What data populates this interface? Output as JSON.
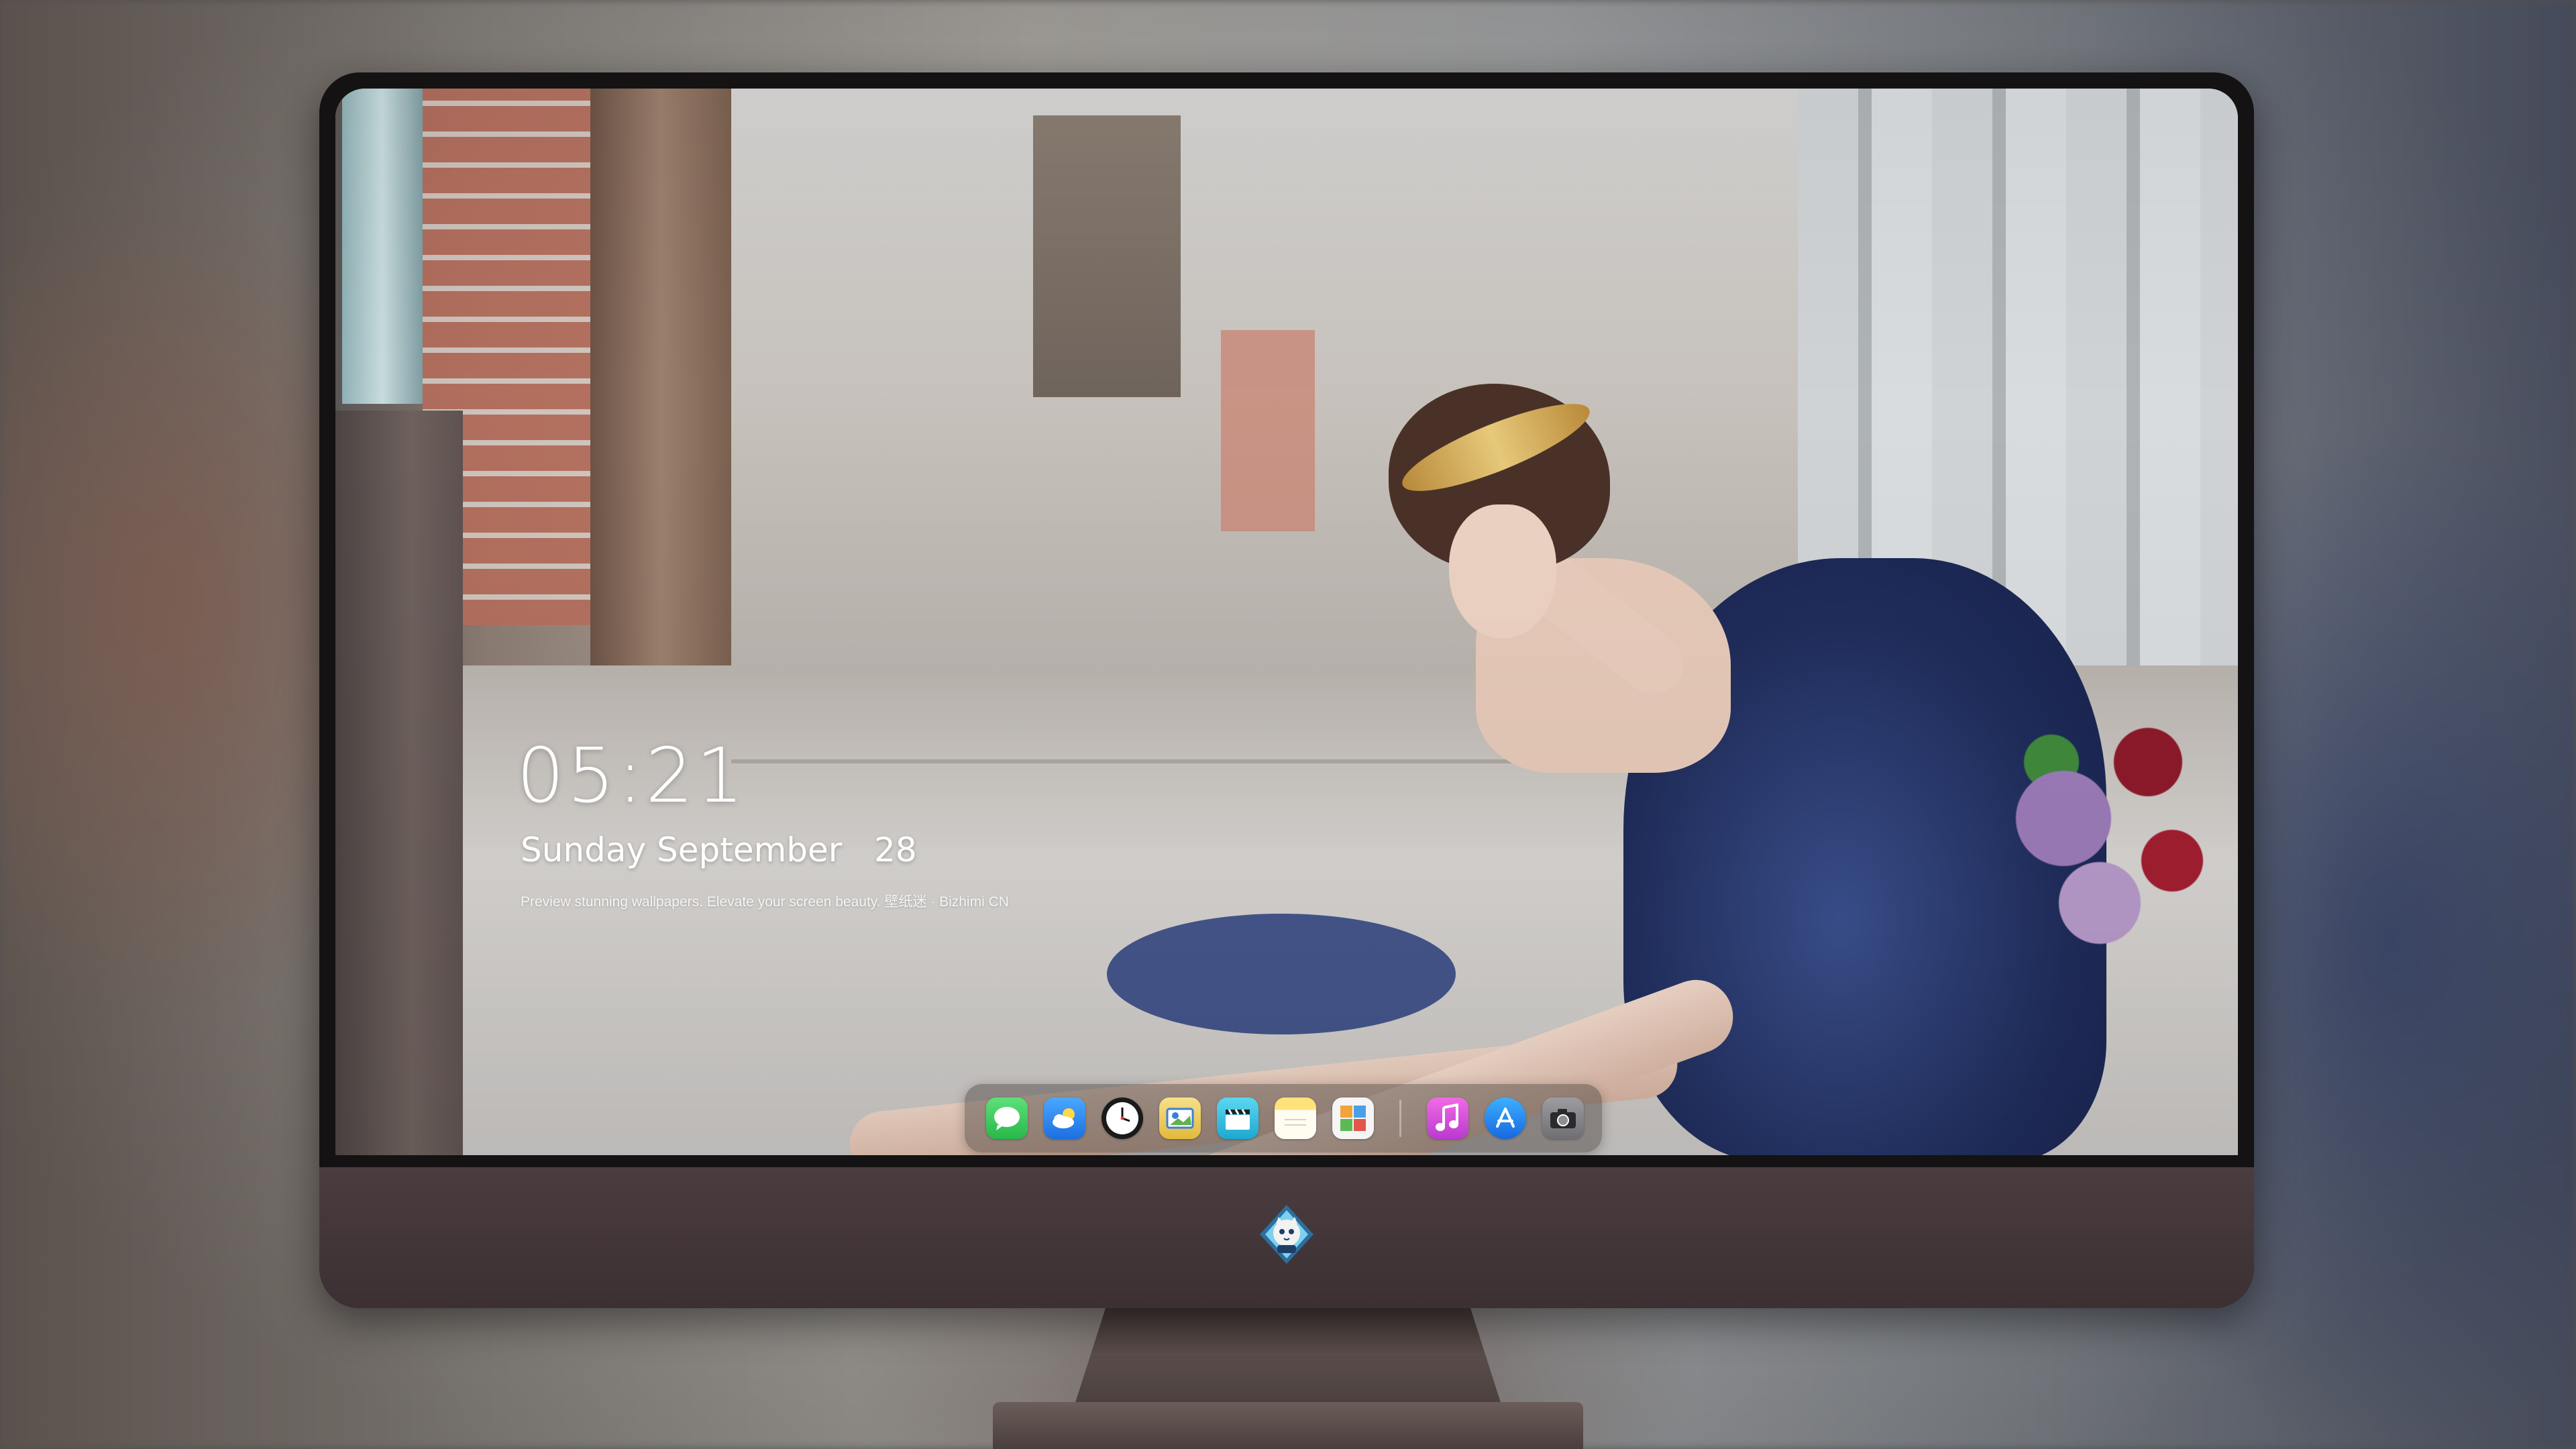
{
  "lockscreen": {
    "time": "05:21",
    "date": "Sunday September   28",
    "tagline": "Preview stunning wallpapers. Elevate your screen beauty. 壁纸迷 · Bizhimi CN"
  },
  "dock": {
    "apps": [
      {
        "name": "messages",
        "icon": "message-bubble-icon",
        "color": "#35c759"
      },
      {
        "name": "weather",
        "icon": "cloud-sun-icon",
        "color": "#2f8df0"
      },
      {
        "name": "clock",
        "icon": "clock-icon",
        "color": "#ffffff"
      },
      {
        "name": "preview",
        "icon": "photo-preview-icon",
        "color": "#f2d34b"
      },
      {
        "name": "clips",
        "icon": "clapperboard-icon",
        "color": "#37c8e8"
      },
      {
        "name": "notes",
        "icon": "notes-icon",
        "color": "#ffd54a"
      },
      {
        "name": "photo-gallery",
        "icon": "gallery-grid-icon",
        "color": "#f5f5f5"
      },
      {
        "name": "music",
        "icon": "music-note-icon",
        "color": "#e24bd6"
      },
      {
        "name": "app-store",
        "icon": "app-store-icon",
        "color": "#1f8df4"
      },
      {
        "name": "camera",
        "icon": "camera-icon",
        "color": "#8e8e93"
      }
    ]
  },
  "brand": {
    "logo": "cat-mascot-logo"
  }
}
